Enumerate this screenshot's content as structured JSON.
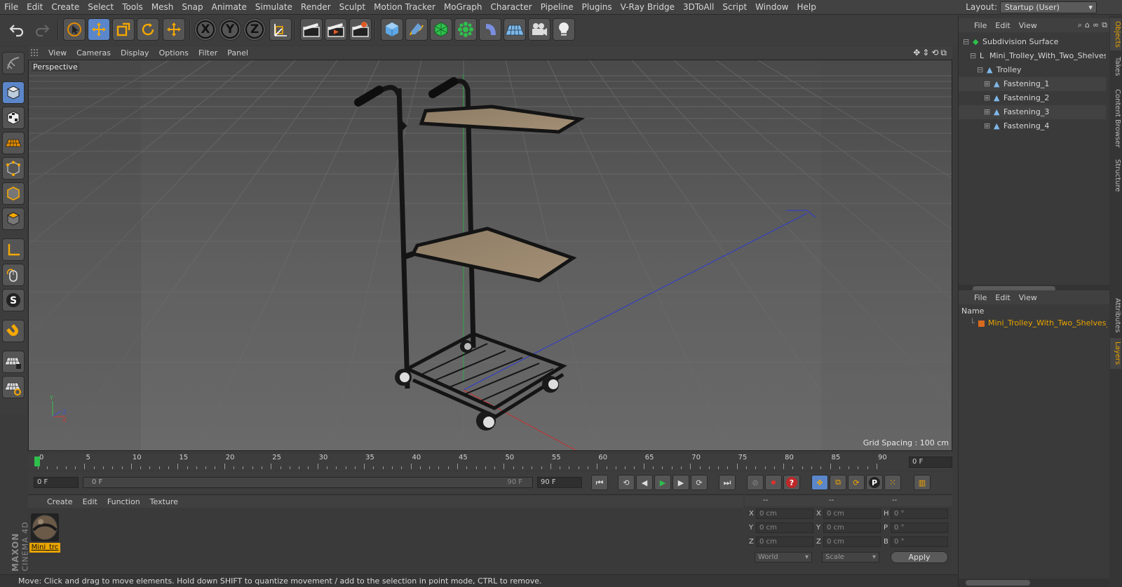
{
  "menubar": {
    "items": [
      "File",
      "Edit",
      "Create",
      "Select",
      "Tools",
      "Mesh",
      "Snap",
      "Animate",
      "Simulate",
      "Render",
      "Sculpt",
      "Motion Tracker",
      "MoGraph",
      "Character",
      "Pipeline",
      "Plugins",
      "V-Ray Bridge",
      "3DToAll",
      "Script",
      "Window",
      "Help"
    ],
    "layout_label": "Layout:",
    "layout_value": "Startup (User)"
  },
  "toolbar": {
    "axis_x": "X",
    "axis_y": "Y",
    "axis_z": "Z"
  },
  "viewport": {
    "menu": [
      "View",
      "Cameras",
      "Display",
      "Options",
      "Filter",
      "Panel"
    ],
    "label": "Perspective",
    "grid_spacing": "Grid Spacing : 100 cm"
  },
  "timeline": {
    "ticks": [
      "0",
      "5",
      "10",
      "15",
      "20",
      "25",
      "30",
      "35",
      "40",
      "45",
      "50",
      "55",
      "60",
      "65",
      "70",
      "75",
      "80",
      "85",
      "90"
    ],
    "current_frame": "0 F"
  },
  "transport": {
    "start_field": "0 F",
    "range_start": "0 F",
    "range_end": "90 F",
    "end_field": "90 F"
  },
  "materials": {
    "menu": [
      "Create",
      "Edit",
      "Function",
      "Texture"
    ],
    "material_name": "Mini_trc"
  },
  "coords": {
    "header": [
      "--",
      "--",
      "--"
    ],
    "rows": [
      {
        "a": "X",
        "av": "0 cm",
        "b": "X",
        "bv": "0 cm",
        "c": "H",
        "cv": "0 °"
      },
      {
        "a": "Y",
        "av": "0 cm",
        "b": "Y",
        "bv": "0 cm",
        "c": "P",
        "cv": "0 °"
      },
      {
        "a": "Z",
        "av": "0 cm",
        "b": "Z",
        "bv": "0 cm",
        "c": "B",
        "cv": "0 °"
      }
    ],
    "world": "World",
    "scale": "Scale",
    "apply": "Apply"
  },
  "status": "Move: Click and drag to move elements. Hold down SHIFT to quantize movement / add to the selection in point mode, CTRL to remove.",
  "objects": {
    "menu": [
      "File",
      "Edit",
      "View"
    ],
    "tree": [
      {
        "name": "Subdivision Surface",
        "indent": 0
      },
      {
        "name": "Mini_Trolley_With_Two_Shelves_",
        "indent": 1
      },
      {
        "name": "Trolley",
        "indent": 2
      },
      {
        "name": "Fastening_1",
        "indent": 3
      },
      {
        "name": "Fastening_2",
        "indent": 3
      },
      {
        "name": "Fastening_3",
        "indent": 3
      },
      {
        "name": "Fastening_4",
        "indent": 3
      }
    ]
  },
  "layers": {
    "menu": [
      "File",
      "Edit",
      "View"
    ],
    "column": "Name",
    "item": "Mini_Trolley_With_Two_Shelves_B"
  },
  "sidetabs": [
    "Objects",
    "Takes",
    "Content Browser",
    "Structure",
    "Attributes",
    "Layers"
  ],
  "brand": {
    "maxon": "MAXON",
    "cinema": "CINEMA 4D"
  },
  "colors": {
    "accent": "#e8a400",
    "selected": "#5b86c9",
    "green": "#2fbf4c"
  }
}
